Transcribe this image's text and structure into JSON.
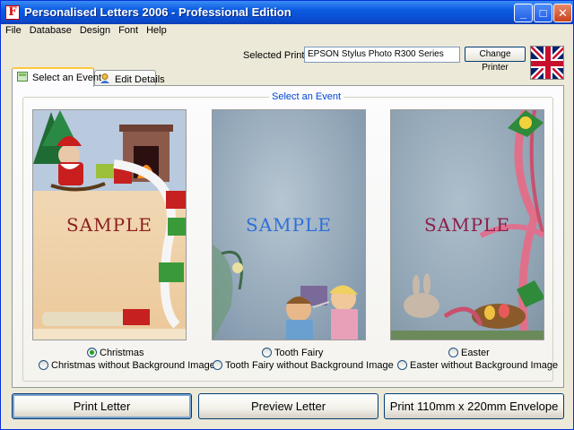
{
  "window": {
    "title": "Personalised Letters 2006 - Professional Edition",
    "app_icon_letter": "F",
    "minimize_glyph": "_",
    "maximize_glyph": "□",
    "close_glyph": "✕"
  },
  "menu": [
    "File",
    "Database",
    "Design",
    "Font",
    "Help"
  ],
  "printer": {
    "label": "Selected Printer",
    "value": "EPSON Stylus Photo R300 Series",
    "change_label": "Change Printer"
  },
  "flag_icon": "union-jack-flag-icon",
  "tabs": [
    {
      "label": "Select an Event",
      "active": true
    },
    {
      "label": "Edit Details",
      "active": false
    }
  ],
  "group_title": "Select an Event",
  "events": [
    {
      "sample": "SAMPLE",
      "sample_color": "#8b1f1f",
      "option_main": "Christmas",
      "option_alt": "Christmas without Background Image",
      "selected": true
    },
    {
      "sample": "SAMPLE",
      "sample_color": "#2f6fd8",
      "option_main": "Tooth Fairy",
      "option_alt": "Tooth Fairy without Background Image",
      "selected": false
    },
    {
      "sample": "SAMPLE",
      "sample_color": "#8b1f4a",
      "option_main": "Easter",
      "option_alt": "Easter without Background Image",
      "selected": false
    }
  ],
  "buttons": {
    "print_letter": "Print Letter",
    "preview_letter": "Preview Letter",
    "print_envelope": "Print 110mm x 220mm Envelope"
  },
  "colors": {
    "titlebar": "#0a5ae0",
    "accent": "#0046d5"
  }
}
